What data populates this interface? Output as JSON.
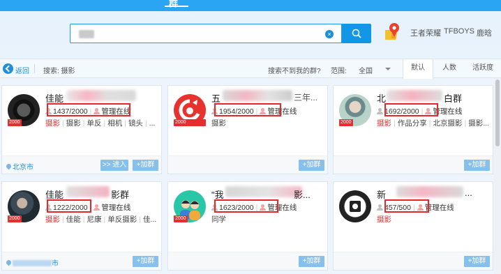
{
  "nav": {
    "active_label": "群"
  },
  "search": {
    "query_blurred": true
  },
  "hot_searches": [
    "王者荣耀",
    "TFBOYS",
    "鹿晗"
  ],
  "filter": {
    "back_label": "返回",
    "search_label": "搜索: 摄影",
    "not_found_label": "搜索不到我的群?",
    "scope_label": "范围:",
    "scope_value": "全国",
    "sort_tabs": [
      "默认",
      "人数",
      "活跃度"
    ],
    "active_sort": "默认"
  },
  "cards": [
    {
      "name": "佳能",
      "members": "1437/2000",
      "admin": "管理在线",
      "tags": [
        "摄影",
        "摄影",
        "单反",
        "相机",
        "镜头",
        "..."
      ],
      "location": "北京市",
      "enter_label": ">> 进入",
      "join_label": "+加群",
      "badge": "2000"
    },
    {
      "name": "五",
      "name_suffix": "三年...",
      "members": "1954/2000",
      "admin": "管理在线",
      "tags": [
        "摄影"
      ],
      "location": "",
      "join_label": "+加群",
      "badge": "2000"
    },
    {
      "name": "北",
      "name_suffix": "白群",
      "members": "1692/2000",
      "admin": "管理在线",
      "tags": [
        "摄影",
        "作品分享",
        "北京摄影",
        "摄影..."
      ],
      "location": "",
      "join_label": "+加群",
      "badge": "2000"
    },
    {
      "name": "佳能",
      "name_suffix": "影群",
      "members": "1222/2000",
      "admin": "管理在线",
      "tags": [
        "摄影",
        "佳能",
        "尼康",
        "单反摄影",
        "佳..."
      ],
      "location_suffix": "市",
      "join_label": "+加群",
      "badge": "2000"
    },
    {
      "name": "\"我",
      "name_suffix": "影...",
      "members": "1623/2000",
      "admin": "管理在线",
      "tags": [
        "同学"
      ],
      "location": "",
      "join_label": "+加群",
      "badge": "2000"
    },
    {
      "name": "新",
      "name_suffix": "...",
      "members": "457/500",
      "admin": "管理在线",
      "tags": [
        "摄影"
      ],
      "location": "",
      "join_label": "+加群",
      "badge": ""
    }
  ],
  "colors": {
    "accent": "#1e8fd8",
    "highlight": "#e8262a",
    "badge": "#e62e2e"
  }
}
